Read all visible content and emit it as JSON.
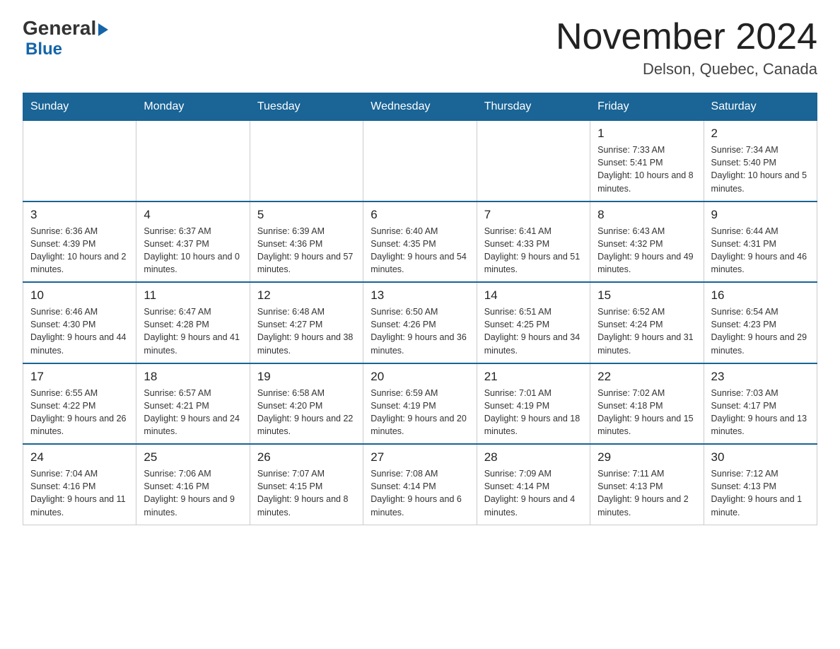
{
  "header": {
    "logo_general": "General",
    "logo_blue": "Blue",
    "month_title": "November 2024",
    "location": "Delson, Quebec, Canada"
  },
  "weekdays": [
    "Sunday",
    "Monday",
    "Tuesday",
    "Wednesday",
    "Thursday",
    "Friday",
    "Saturday"
  ],
  "weeks": [
    [
      {
        "day": "",
        "info": ""
      },
      {
        "day": "",
        "info": ""
      },
      {
        "day": "",
        "info": ""
      },
      {
        "day": "",
        "info": ""
      },
      {
        "day": "",
        "info": ""
      },
      {
        "day": "1",
        "info": "Sunrise: 7:33 AM\nSunset: 5:41 PM\nDaylight: 10 hours and 8 minutes."
      },
      {
        "day": "2",
        "info": "Sunrise: 7:34 AM\nSunset: 5:40 PM\nDaylight: 10 hours and 5 minutes."
      }
    ],
    [
      {
        "day": "3",
        "info": "Sunrise: 6:36 AM\nSunset: 4:39 PM\nDaylight: 10 hours and 2 minutes."
      },
      {
        "day": "4",
        "info": "Sunrise: 6:37 AM\nSunset: 4:37 PM\nDaylight: 10 hours and 0 minutes."
      },
      {
        "day": "5",
        "info": "Sunrise: 6:39 AM\nSunset: 4:36 PM\nDaylight: 9 hours and 57 minutes."
      },
      {
        "day": "6",
        "info": "Sunrise: 6:40 AM\nSunset: 4:35 PM\nDaylight: 9 hours and 54 minutes."
      },
      {
        "day": "7",
        "info": "Sunrise: 6:41 AM\nSunset: 4:33 PM\nDaylight: 9 hours and 51 minutes."
      },
      {
        "day": "8",
        "info": "Sunrise: 6:43 AM\nSunset: 4:32 PM\nDaylight: 9 hours and 49 minutes."
      },
      {
        "day": "9",
        "info": "Sunrise: 6:44 AM\nSunset: 4:31 PM\nDaylight: 9 hours and 46 minutes."
      }
    ],
    [
      {
        "day": "10",
        "info": "Sunrise: 6:46 AM\nSunset: 4:30 PM\nDaylight: 9 hours and 44 minutes."
      },
      {
        "day": "11",
        "info": "Sunrise: 6:47 AM\nSunset: 4:28 PM\nDaylight: 9 hours and 41 minutes."
      },
      {
        "day": "12",
        "info": "Sunrise: 6:48 AM\nSunset: 4:27 PM\nDaylight: 9 hours and 38 minutes."
      },
      {
        "day": "13",
        "info": "Sunrise: 6:50 AM\nSunset: 4:26 PM\nDaylight: 9 hours and 36 minutes."
      },
      {
        "day": "14",
        "info": "Sunrise: 6:51 AM\nSunset: 4:25 PM\nDaylight: 9 hours and 34 minutes."
      },
      {
        "day": "15",
        "info": "Sunrise: 6:52 AM\nSunset: 4:24 PM\nDaylight: 9 hours and 31 minutes."
      },
      {
        "day": "16",
        "info": "Sunrise: 6:54 AM\nSunset: 4:23 PM\nDaylight: 9 hours and 29 minutes."
      }
    ],
    [
      {
        "day": "17",
        "info": "Sunrise: 6:55 AM\nSunset: 4:22 PM\nDaylight: 9 hours and 26 minutes."
      },
      {
        "day": "18",
        "info": "Sunrise: 6:57 AM\nSunset: 4:21 PM\nDaylight: 9 hours and 24 minutes."
      },
      {
        "day": "19",
        "info": "Sunrise: 6:58 AM\nSunset: 4:20 PM\nDaylight: 9 hours and 22 minutes."
      },
      {
        "day": "20",
        "info": "Sunrise: 6:59 AM\nSunset: 4:19 PM\nDaylight: 9 hours and 20 minutes."
      },
      {
        "day": "21",
        "info": "Sunrise: 7:01 AM\nSunset: 4:19 PM\nDaylight: 9 hours and 18 minutes."
      },
      {
        "day": "22",
        "info": "Sunrise: 7:02 AM\nSunset: 4:18 PM\nDaylight: 9 hours and 15 minutes."
      },
      {
        "day": "23",
        "info": "Sunrise: 7:03 AM\nSunset: 4:17 PM\nDaylight: 9 hours and 13 minutes."
      }
    ],
    [
      {
        "day": "24",
        "info": "Sunrise: 7:04 AM\nSunset: 4:16 PM\nDaylight: 9 hours and 11 minutes."
      },
      {
        "day": "25",
        "info": "Sunrise: 7:06 AM\nSunset: 4:16 PM\nDaylight: 9 hours and 9 minutes."
      },
      {
        "day": "26",
        "info": "Sunrise: 7:07 AM\nSunset: 4:15 PM\nDaylight: 9 hours and 8 minutes."
      },
      {
        "day": "27",
        "info": "Sunrise: 7:08 AM\nSunset: 4:14 PM\nDaylight: 9 hours and 6 minutes."
      },
      {
        "day": "28",
        "info": "Sunrise: 7:09 AM\nSunset: 4:14 PM\nDaylight: 9 hours and 4 minutes."
      },
      {
        "day": "29",
        "info": "Sunrise: 7:11 AM\nSunset: 4:13 PM\nDaylight: 9 hours and 2 minutes."
      },
      {
        "day": "30",
        "info": "Sunrise: 7:12 AM\nSunset: 4:13 PM\nDaylight: 9 hours and 1 minute."
      }
    ]
  ]
}
